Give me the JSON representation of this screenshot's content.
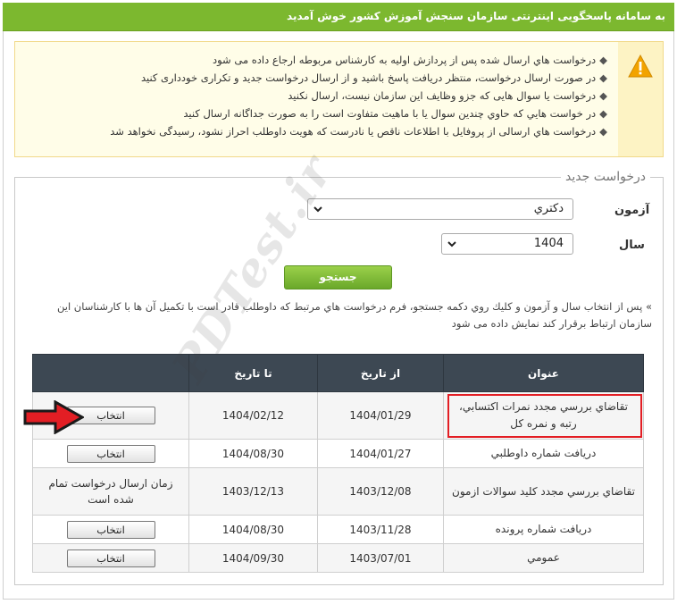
{
  "header": {
    "title": "به سامانه پاسخگويی اينترنتی سازمان سنجش آموزش كشور خوش آمديد"
  },
  "notice": {
    "icon": "warning-icon",
    "items": [
      "درخواست هاي ارسال شده پس از پردازش اوليه به كارشناس مربوطه ارجاع داده می شود",
      "در صورت ارسال درخواست، منتظر دريافت پاسخ باشيد و از ارسال درخواست جديد و تكراری خودداری كنيد",
      "درخواست یا سوال هایی که جزو وظايف اين سازمان نيست، ارسال نکنيد",
      "در خواست هايي كه حاوي چندين سوال يا با ماهيت متفاوت است را به صورت جداگانه ارسال كنيد",
      "درخواست هاي ارسالی از پروفايل با اطلاعات ناقص يا نادرست كه هويت داوطلب احراز نشود، رسيدگی نخواهد شد"
    ]
  },
  "form": {
    "legend": "درخواست جدید",
    "exam_label": "آزمون",
    "exam_value": "دکتري",
    "year_label": "سال",
    "year_value": "1404",
    "search_label": "جستجو",
    "hint": "» پس از انتخاب سال و آزمون و كليك روي دكمه جستجو، فرم درخواست هاي مرتبط كه داوطلب قادر است با تكميل آن ها با كارشناسان اين سازمان ارتباط برقرار كند نمايش داده می شود"
  },
  "table": {
    "headers": {
      "title": "عنوان",
      "from": "از تاریخ",
      "to": "تا تاریخ",
      "action": ""
    },
    "rows": [
      {
        "title": "تقاضاي بررسي مجدد نمرات اكتسابي، رتبه و نمره كل",
        "from": "1404/01/29",
        "to": "1404/02/12",
        "action": "انتخاب"
      },
      {
        "title": "دريافت شماره داوطلبي",
        "from": "1404/01/27",
        "to": "1404/08/30",
        "action": "انتخاب"
      },
      {
        "title": "تقاضاي بررسي مجدد كليد سوالات ازمون",
        "from": "1403/12/08",
        "to": "1403/12/13",
        "status": "زمان ارسال درخواست تمام شده است"
      },
      {
        "title": "دريافت شماره پرونده",
        "from": "1403/11/28",
        "to": "1404/08/30",
        "action": "انتخاب"
      },
      {
        "title": "عمومي",
        "from": "1403/07/01",
        "to": "1404/09/30",
        "action": "انتخاب"
      }
    ]
  },
  "watermark": "PDTest.ir",
  "colors": {
    "header": "#7cb82f",
    "table_header": "#3d4853",
    "highlight": "#e31e24",
    "notice_bg": "#fffde8"
  }
}
